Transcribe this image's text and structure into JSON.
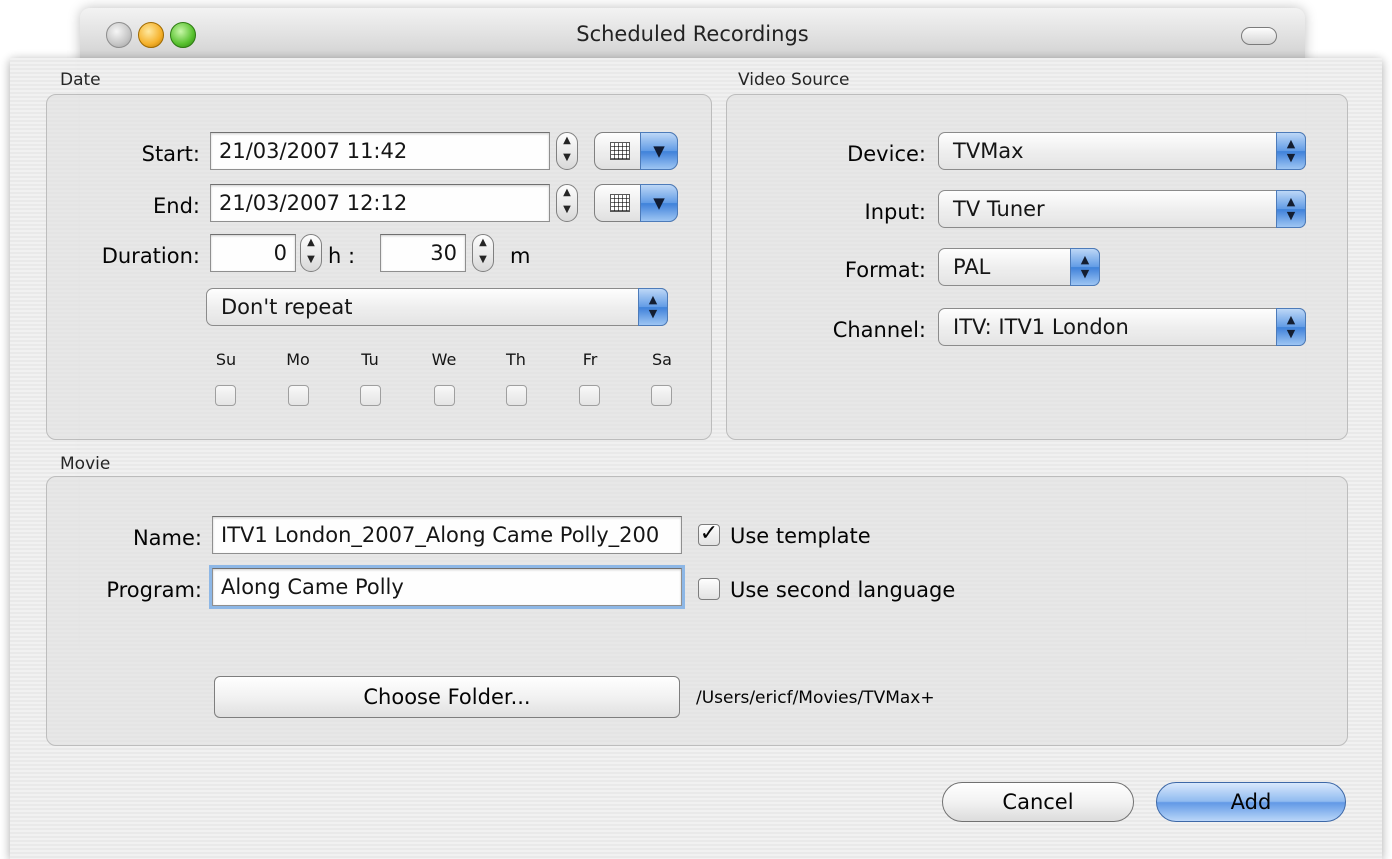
{
  "window": {
    "title": "Scheduled Recordings"
  },
  "date": {
    "group_label": "Date",
    "start_label": "Start:",
    "start_value": "21/03/2007 11:42",
    "end_label": "End:",
    "end_value": "21/03/2007 12:12",
    "duration_label": "Duration:",
    "duration_hours": "0",
    "hours_unit": "h :",
    "duration_minutes": "30",
    "minutes_unit": "m",
    "repeat_value": "Don't repeat",
    "days": [
      "Su",
      "Mo",
      "Tu",
      "We",
      "Th",
      "Fr",
      "Sa"
    ]
  },
  "video_source": {
    "group_label": "Video Source",
    "device_label": "Device:",
    "device_value": "TVMax",
    "input_label": "Input:",
    "input_value": "TV Tuner",
    "format_label": "Format:",
    "format_value": "PAL",
    "channel_label": "Channel:",
    "channel_value": "ITV: ITV1 London"
  },
  "movie": {
    "group_label": "Movie",
    "name_label": "Name:",
    "name_value": "ITV1 London_2007_Along Came Polly_200",
    "program_label": "Program:",
    "program_value": "Along Came Polly",
    "use_template_label": "Use template",
    "use_template_checked": true,
    "use_second_language_label": "Use second language",
    "use_second_language_checked": false,
    "choose_folder_label": "Choose Folder...",
    "folder_path": "/Users/ericf/Movies/TVMax+"
  },
  "buttons": {
    "cancel": "Cancel",
    "add": "Add"
  },
  "colors": {
    "accent": "#5f98e6",
    "focus_ring": "#8cb6e6"
  }
}
